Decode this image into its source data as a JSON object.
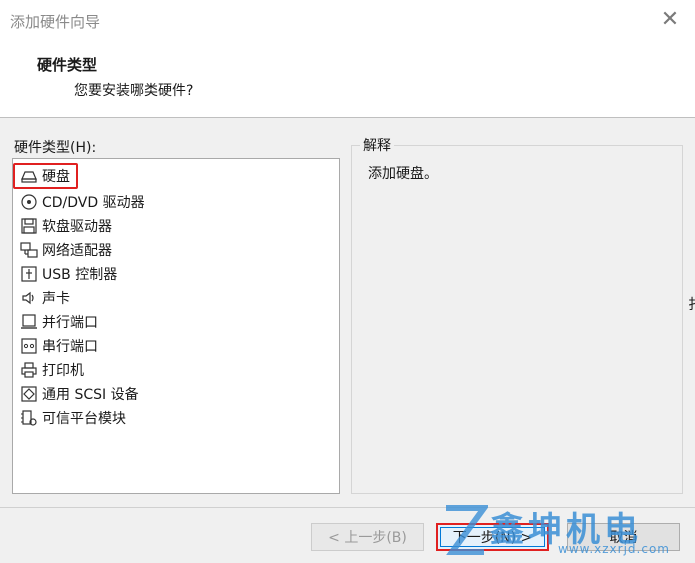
{
  "window": {
    "title": "添加硬件向导",
    "close_glyph": "✕"
  },
  "header": {
    "title": "硬件类型",
    "subtitle": "您要安装哪类硬件?"
  },
  "list": {
    "label": "硬件类型(H):",
    "items": [
      {
        "label": "硬盘",
        "icon": "hard-disk-icon",
        "selected": true
      },
      {
        "label": "CD/DVD 驱动器",
        "icon": "cd-dvd-icon"
      },
      {
        "label": "软盘驱动器",
        "icon": "floppy-icon"
      },
      {
        "label": "网络适配器",
        "icon": "network-icon"
      },
      {
        "label": "USB 控制器",
        "icon": "usb-icon"
      },
      {
        "label": "声卡",
        "icon": "speaker-icon"
      },
      {
        "label": "并行端口",
        "icon": "parallel-port-icon"
      },
      {
        "label": "串行端口",
        "icon": "serial-port-icon"
      },
      {
        "label": "打印机",
        "icon": "printer-icon"
      },
      {
        "label": "通用 SCSI 设备",
        "icon": "scsi-icon"
      },
      {
        "label": "可信平台模块",
        "icon": "tpm-icon"
      }
    ]
  },
  "explanation": {
    "label": "解释",
    "text": "添加硬盘。"
  },
  "buttons": {
    "back": "< 上一步(B)",
    "next": "下一步(N) >",
    "cancel": "取消"
  },
  "watermark": {
    "brand": "鑫坤机电",
    "url": "www.xzxrjd.com"
  },
  "edge_mark": "扌",
  "colors": {
    "highlight_border": "#e02020",
    "focus_blue": "#0078d7",
    "dialog_bg": "#f0f0f0"
  }
}
